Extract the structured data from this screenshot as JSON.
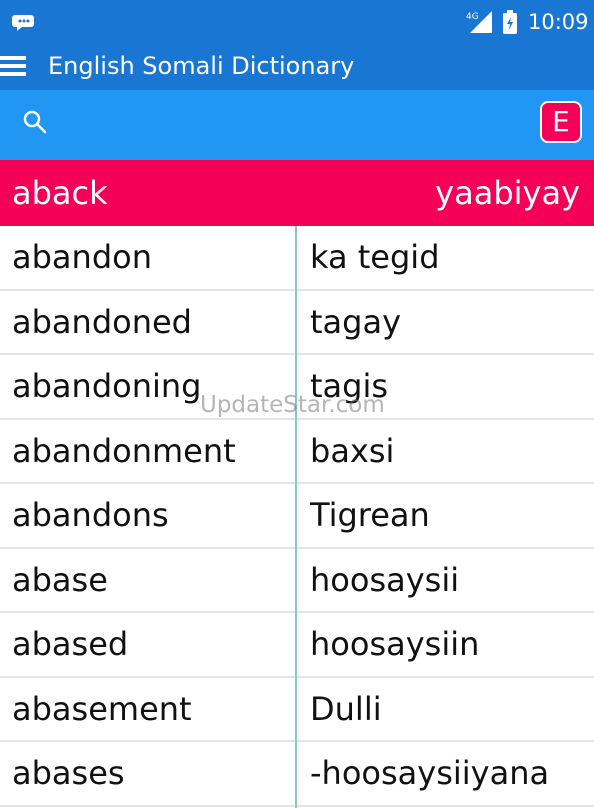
{
  "status_bar": {
    "notification_icon": "chat-bubble-icon",
    "network_label": "4G",
    "time": "10:09"
  },
  "app_bar": {
    "menu_icon": "hamburger-menu-icon",
    "title": "English Somali Dictionary"
  },
  "search": {
    "icon": "search-icon",
    "value": "",
    "placeholder": "",
    "lang_toggle_label": "E"
  },
  "current_entry": {
    "word": "aback",
    "translation": "yaabiyay"
  },
  "entries": [
    {
      "en": "abandon",
      "so": "ka tegid"
    },
    {
      "en": "abandoned",
      "so": "tagay"
    },
    {
      "en": "abandoning",
      "so": "tagis"
    },
    {
      "en": "abandonment",
      "so": "baxsi"
    },
    {
      "en": "abandons",
      "so": "Tigrean"
    },
    {
      "en": "abase",
      "so": "hoosaysii"
    },
    {
      "en": "abased",
      "so": "hoosaysiin"
    },
    {
      "en": "abasement",
      "so": "Dulli"
    },
    {
      "en": "abases",
      "so": "-hoosaysiiyana"
    }
  ],
  "watermark": "UpdateStar.com",
  "colors": {
    "primary": "#1976d2",
    "search_bar": "#2196f3",
    "accent": "#f50057",
    "divider": "#80cbc4"
  }
}
